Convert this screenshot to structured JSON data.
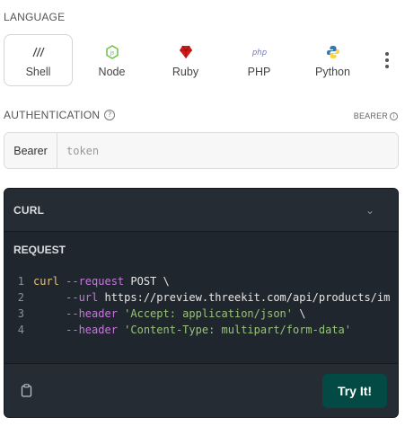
{
  "language": {
    "label": "LANGUAGE",
    "tabs": [
      {
        "label": "Shell",
        "icon": "shell-icon",
        "active": true
      },
      {
        "label": "Node",
        "icon": "node-icon",
        "active": false
      },
      {
        "label": "Ruby",
        "icon": "ruby-icon",
        "active": false
      },
      {
        "label": "PHP",
        "icon": "php-icon",
        "active": false
      },
      {
        "label": "Python",
        "icon": "python-icon",
        "active": false
      }
    ],
    "more_icon": "more-vertical-icon"
  },
  "auth": {
    "label": "AUTHENTICATION",
    "tag": "BEARER",
    "prefix": "Bearer",
    "placeholder": "token",
    "value": ""
  },
  "request": {
    "header": "CURL",
    "section_label": "REQUEST",
    "lines": [
      {
        "num": "1",
        "parts": [
          [
            "t-cmd",
            "curl"
          ],
          [
            "t-flag",
            " --request"
          ],
          [
            "t-plain",
            " POST \\"
          ]
        ]
      },
      {
        "num": "2",
        "parts": [
          [
            "t-flag",
            "     --url"
          ],
          [
            "t-plain",
            " https://preview.threekit.com/api/products/im"
          ]
        ]
      },
      {
        "num": "3",
        "parts": [
          [
            "t-flag",
            "     --header"
          ],
          [
            "t-str",
            " 'Accept: application/json'"
          ],
          [
            "t-plain",
            " \\"
          ]
        ]
      },
      {
        "num": "4",
        "parts": [
          [
            "t-flag",
            "     --header"
          ],
          [
            "t-str",
            " 'Content-Type: multipart/form-data'"
          ]
        ]
      }
    ],
    "try_label": "Try It!"
  },
  "colors": {
    "try_button": "#034a44",
    "code_bg": "#20262d"
  }
}
